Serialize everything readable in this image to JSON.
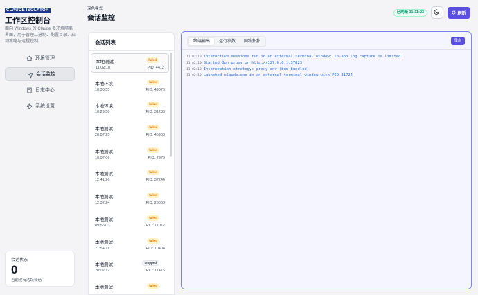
{
  "sidebar": {
    "brand_tag": "CLAUDE ISOLATOR",
    "brand_title": "工作区控制台",
    "brand_desc": "面向 Windows 的 Claude 多环境隔离界面，用于管理二进制、配置目录、启动策略与远程控制。",
    "items": [
      {
        "label": "环境管理",
        "icon": "home-icon"
      },
      {
        "label": "会话监控",
        "icon": "send-icon"
      },
      {
        "label": "日志中心",
        "icon": "document-icon"
      },
      {
        "label": "系统设置",
        "icon": "settings-icon"
      }
    ],
    "status": {
      "label": "会话状态",
      "count": "0",
      "note": "当前没有活跃会话"
    }
  },
  "header": {
    "crumb": "深色模式",
    "title": "会话监控",
    "last_refresh": "已刷新 11:11:23",
    "refresh_label": "刷新"
  },
  "sessions": {
    "title": "会话列表",
    "items": [
      {
        "name": "本地测试",
        "time": "11:02:10",
        "pid": "PID: 4412",
        "status": "failed"
      },
      {
        "name": "本地环境",
        "time": "10:30:55",
        "pid": "PID: 49076",
        "status": "failed"
      },
      {
        "name": "本地环境",
        "time": "10:29:56",
        "pid": "PID: 31236",
        "status": "failed"
      },
      {
        "name": "本地测试",
        "time": "20:07:25",
        "pid": "PID: 45968",
        "status": "failed"
      },
      {
        "name": "本地测试",
        "time": "10:07:06",
        "pid": "PID: 2976",
        "status": "failed"
      },
      {
        "name": "本地测试",
        "time": "12:41:26",
        "pid": "PID: 37244",
        "status": "failed"
      },
      {
        "name": "本地测试",
        "time": "12:32:24",
        "pid": "PID: 26068",
        "status": "failed"
      },
      {
        "name": "本地测试",
        "time": "09:56:03",
        "pid": "PID: 11072",
        "status": "failed"
      },
      {
        "name": "本地测试",
        "time": "21:54:11",
        "pid": "PID: 10404",
        "status": "failed"
      },
      {
        "name": "本地测试",
        "time": "20:02:12",
        "pid": "PID: 11476",
        "status": "stopped"
      },
      {
        "name": "本地测试",
        "time": "",
        "pid": "",
        "status": "failed"
      }
    ]
  },
  "detail": {
    "tabs": [
      "终端输出",
      "运行参数",
      "网络拓扑"
    ],
    "clear_label": "重启",
    "log": [
      {
        "t": "11:02:10",
        "msg": "Interactive sessions run in an external terminal window; in-app log capture is limited."
      },
      {
        "t": "11:02:10",
        "msg": "Started Bun proxy on http://127.0.0.1:37823"
      },
      {
        "t": "11:02:10",
        "msg": "Interception strategy: proxy-env (bun-bundled)"
      },
      {
        "t": "11:02:10",
        "msg": "Launched claude.exe in an external terminal window with PID 31724"
      }
    ]
  },
  "colors": {
    "accent": "#5b4fe0",
    "log_text": "#2f6fd6",
    "badge_failed": "#d97706"
  }
}
